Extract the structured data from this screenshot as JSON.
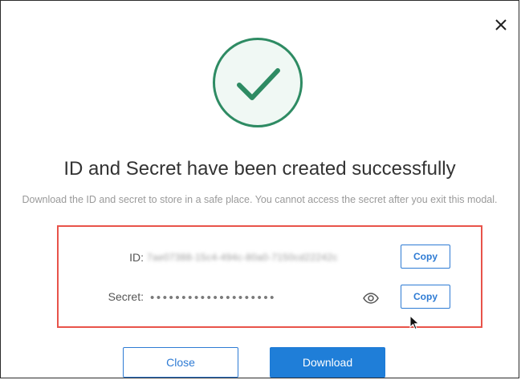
{
  "modal": {
    "close_icon": "close-icon",
    "success_icon": "checkmark-circle-icon",
    "title": "ID and Secret have been created successfully",
    "description": "Download the ID and secret to store in a safe place. You cannot access the secret after you exit this modal."
  },
  "credentials": {
    "id_label": "ID:",
    "id_value": "7ae07388-15c4-494c-80a0-7150cd22242c",
    "id_copy_label": "Copy",
    "secret_label": "Secret:",
    "secret_value": "••••••••••••••••••••",
    "secret_visibility_icon": "eye-icon",
    "secret_copy_label": "Copy"
  },
  "actions": {
    "close_label": "Close",
    "download_label": "Download"
  },
  "colors": {
    "success_green": "#2e8b63",
    "highlight_red": "#e8534a",
    "primary_blue": "#1f7ed8"
  }
}
